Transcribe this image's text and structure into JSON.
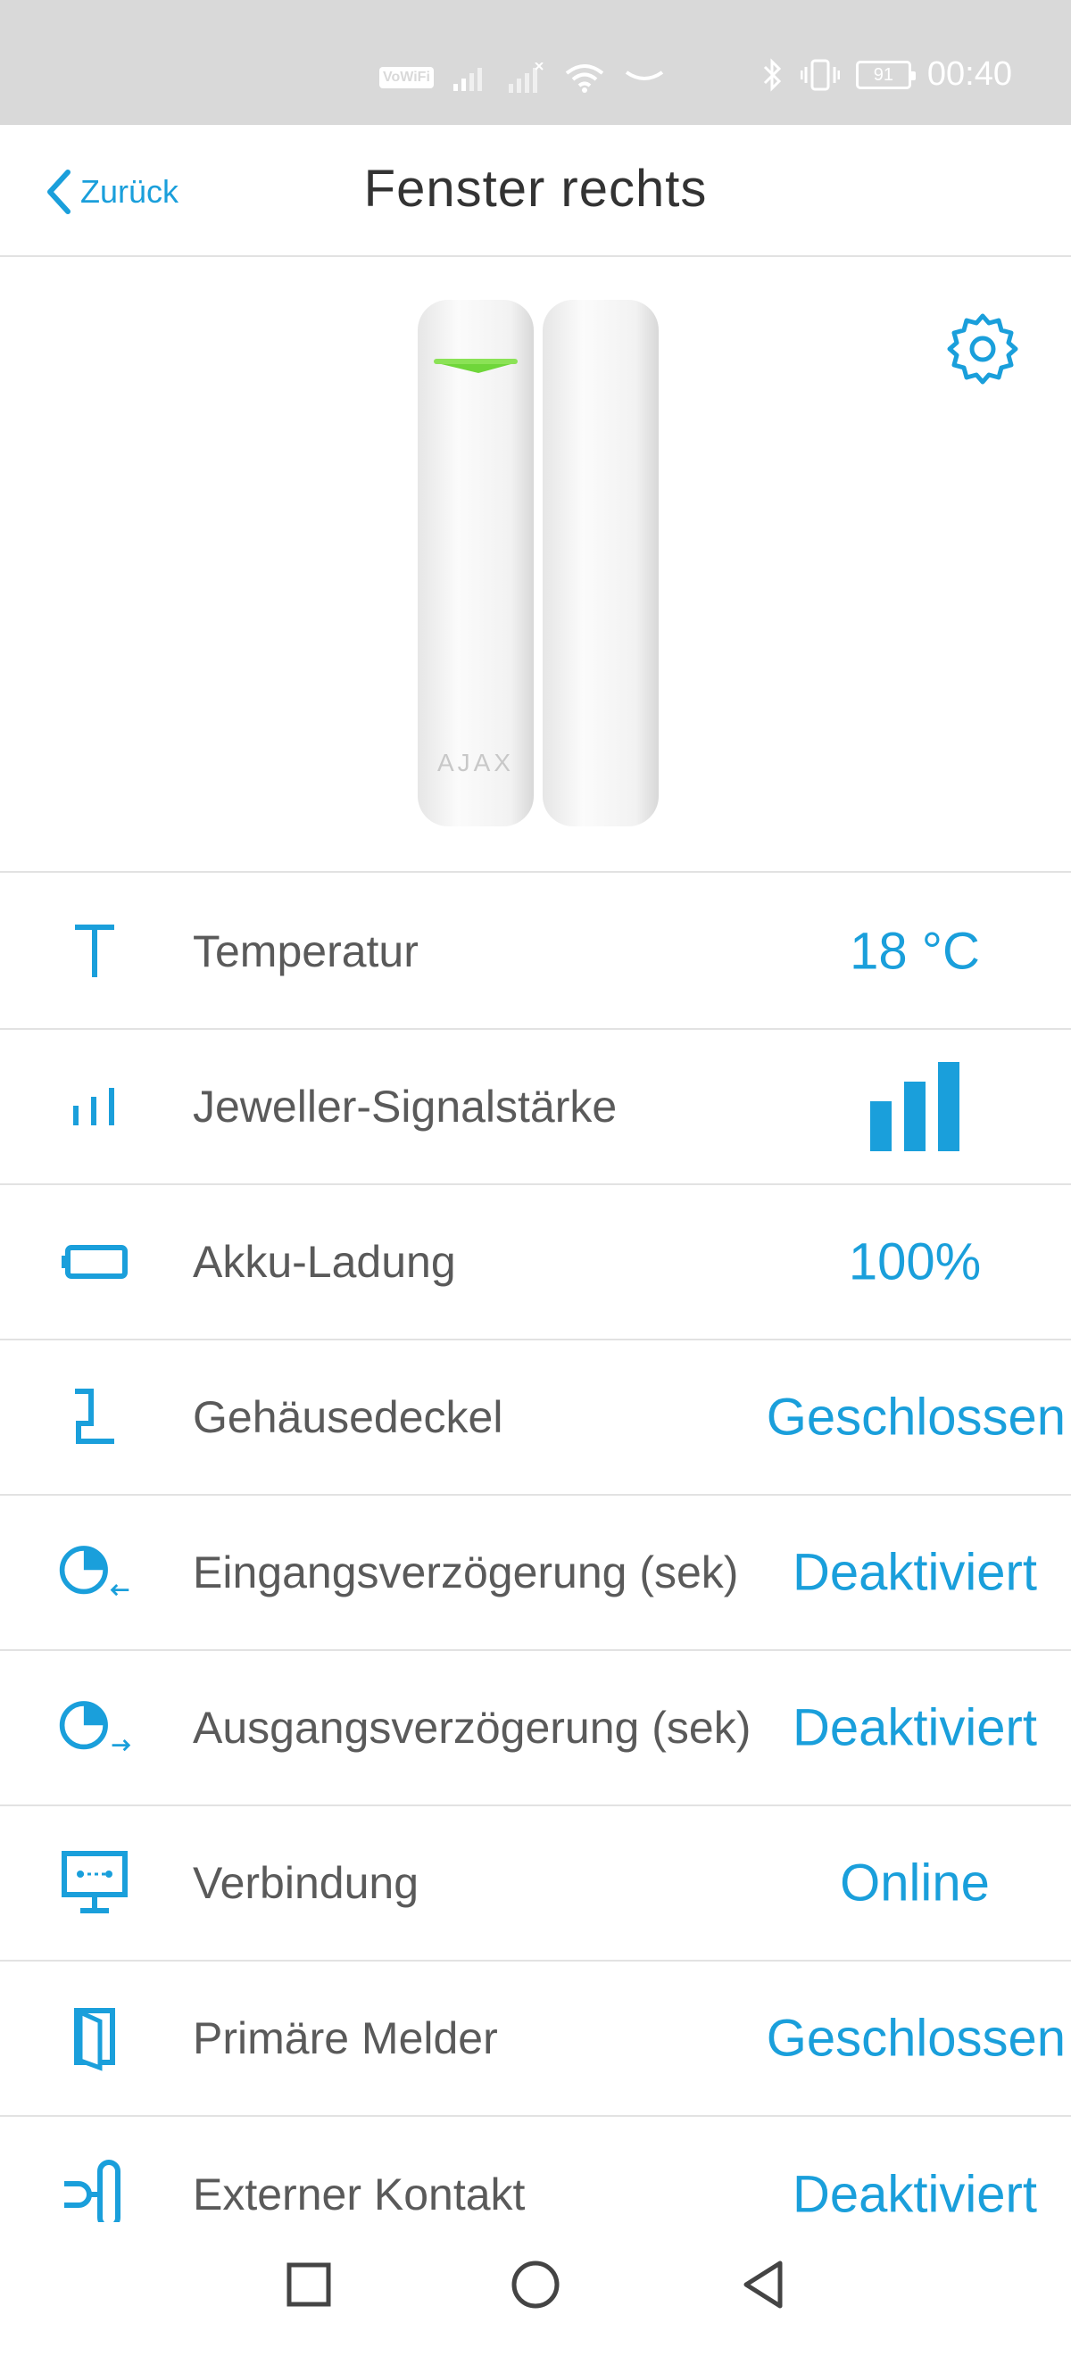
{
  "status_bar": {
    "volte": "VoWiFi",
    "battery": "91",
    "time": "00:40"
  },
  "header": {
    "back_label": "Zurück",
    "title": "Fenster rechts"
  },
  "device": {
    "brand_mark": "AJAX"
  },
  "rows": [
    {
      "icon": "temperature-icon",
      "label": "Temperatur",
      "value": "18 °C"
    },
    {
      "icon": "signal-strength-icon",
      "label": "Jeweller-Signalstärke",
      "value": "",
      "signal_bars": 3
    },
    {
      "icon": "battery-icon",
      "label": "Akku-Ladung",
      "value": "100%"
    },
    {
      "icon": "tamper-lid-icon",
      "label": "Gehäusedeckel",
      "value": "Geschlossen"
    },
    {
      "icon": "entry-delay-icon",
      "label": "Eingangsverzögerung (sek)",
      "value": "Deaktiviert"
    },
    {
      "icon": "exit-delay-icon",
      "label": "Ausgangsverzögerung (sek)",
      "value": "Deaktiviert"
    },
    {
      "icon": "connection-icon",
      "label": "Verbindung",
      "value": "Online"
    },
    {
      "icon": "primary-detector-icon",
      "label": "Primäre Melder",
      "value": "Geschlossen"
    },
    {
      "icon": "external-contact-icon",
      "label": "Externer Kontakt",
      "value": "Deaktiviert"
    }
  ],
  "colors": {
    "accent": "#1a9fdb",
    "status_bar_bg": "#d9d9d9",
    "divider": "#e2e2e2",
    "led_green": "#6fd63a"
  }
}
